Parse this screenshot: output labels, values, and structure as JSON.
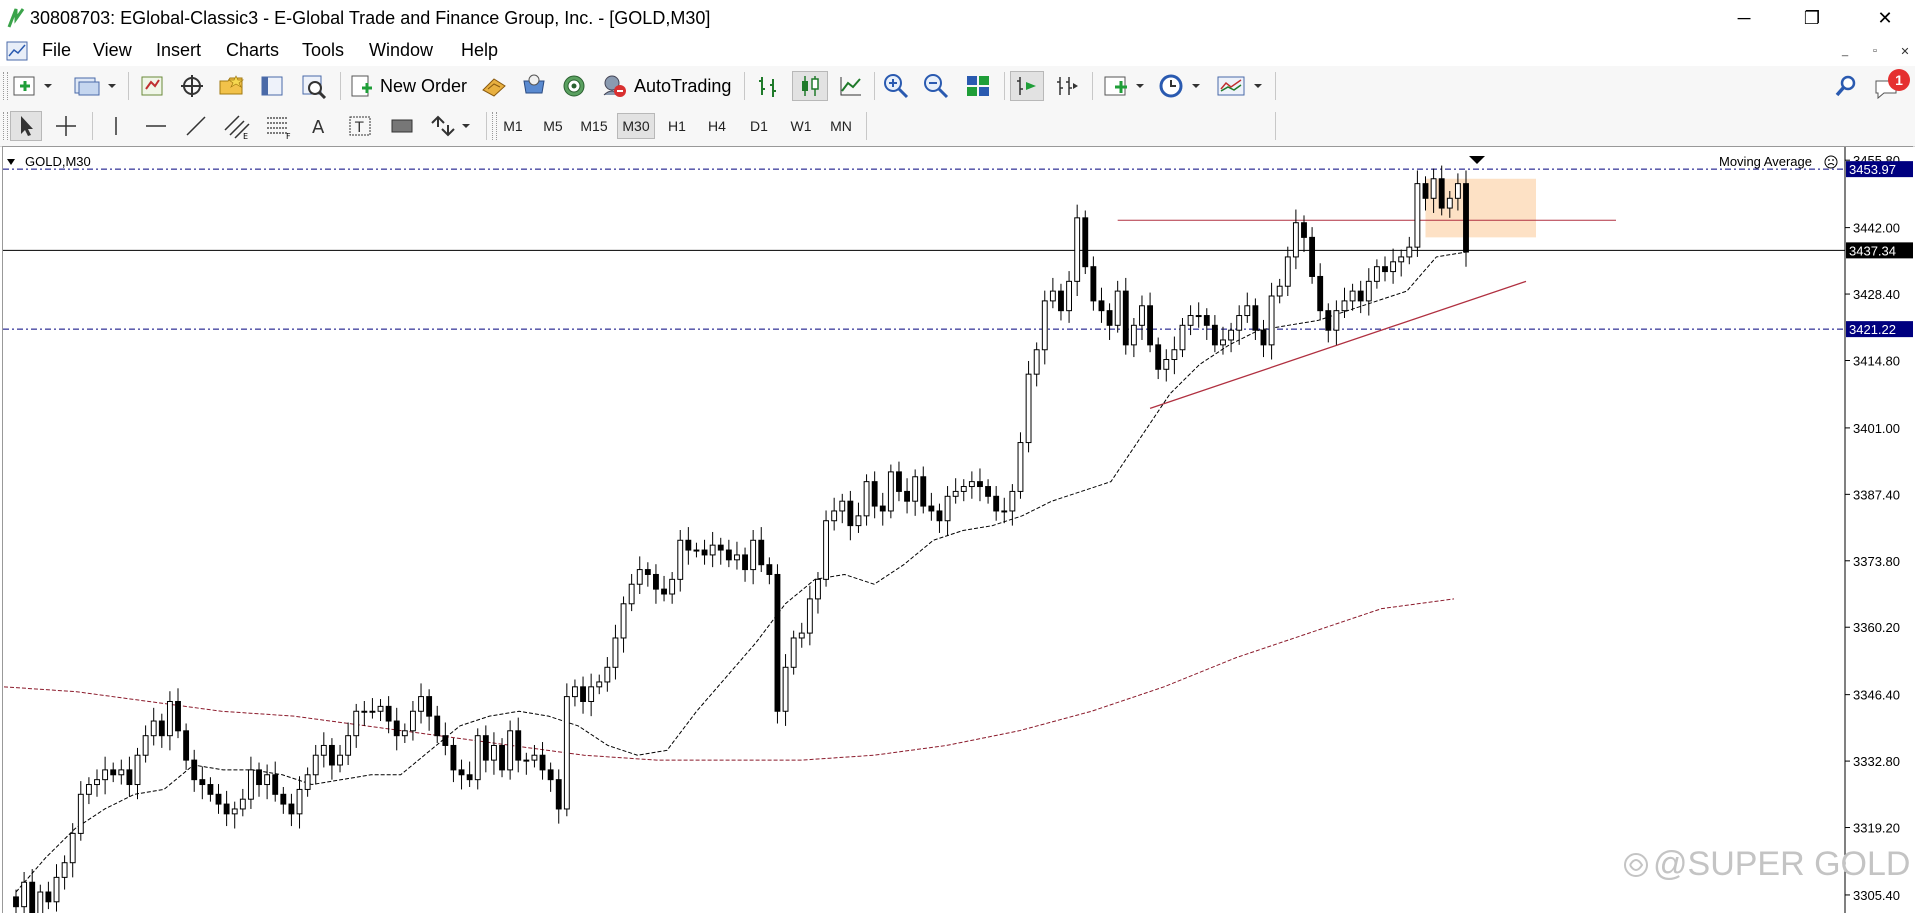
{
  "window": {
    "title": "30808703: EGlobal-Classic3 - E-Global Trade and Finance Group, Inc. - [GOLD,M30]",
    "controls": {
      "minimize": "─",
      "restore": "❐",
      "close": "✕"
    }
  },
  "menu": {
    "items": [
      "File",
      "View",
      "Insert",
      "Charts",
      "Tools",
      "Window",
      "Help"
    ]
  },
  "toolbar": {
    "new_order_label": "New Order",
    "autotrading_label": "AutoTrading",
    "notification_count": "1"
  },
  "timeframes": {
    "items": [
      "M1",
      "M5",
      "M15",
      "M30",
      "H1",
      "H4",
      "D1",
      "W1",
      "MN"
    ],
    "active": "M30"
  },
  "chart": {
    "symbol_label": "GOLD,M30",
    "indicator_label": "Moving Average",
    "watermark": "@SUPER GOLD",
    "price_levels": [
      "3455.80",
      "3442.00",
      "3428.40",
      "3414.80",
      "3401.00",
      "3387.40",
      "3373.80",
      "3360.20",
      "3346.40",
      "3332.80",
      "3319.20",
      "3305.40"
    ],
    "current_price": "3437.34",
    "upper_level": "3453.97",
    "lower_level": "3421.22",
    "colors": {
      "candle": "#000000",
      "ma_fast": "#000000",
      "ma_slow": "#8b1a2b",
      "trendline": "#b03040",
      "highlight_zone": "#fcd9b6",
      "label_box": "#00007f"
    }
  },
  "chart_data": {
    "type": "candlestick",
    "symbol": "GOLD",
    "timeframe": "M30",
    "ylim": [
      3301.5,
      3458.5
    ],
    "current_price": 3437.34,
    "horizontal_lines": [
      3453.97,
      3421.22
    ],
    "resistance_line": 3443.5,
    "closes": [
      3303,
      3308,
      3301,
      3306,
      3304,
      3309,
      3312,
      3318,
      3326,
      3328,
      3329,
      3331,
      3330,
      3331,
      3328,
      3334,
      3338,
      3341,
      3338,
      3345,
      3339,
      3333,
      3329,
      3328,
      3326,
      3324,
      3322,
      3323,
      3325,
      3331,
      3328,
      3330,
      3326,
      3324,
      3322,
      3327,
      3330,
      3334,
      3336,
      3332,
      3334,
      3338,
      3343,
      3343,
      3343,
      3344,
      3341,
      3338,
      3339,
      3343,
      3346,
      3342,
      3338,
      3336,
      3331,
      3330,
      3329,
      3338,
      3333,
      3336,
      3331,
      3339,
      3333,
      3333,
      3334,
      3331,
      3329,
      3323,
      3346,
      3348,
      3345,
      3348,
      3349,
      3352,
      3358,
      3365,
      3369,
      3372,
      3371,
      3368,
      3367,
      3370,
      3378,
      3376,
      3376,
      3375,
      3377,
      3376,
      3374,
      3375,
      3372,
      3378,
      3373,
      3371,
      3343,
      3352,
      3358,
      3359,
      3366,
      3370,
      3382,
      3384,
      3386,
      3381,
      3383,
      3390,
      3385,
      3384,
      3392,
      3388,
      3386,
      3391,
      3385,
      3384,
      3382,
      3387,
      3388,
      3389,
      3390,
      3389,
      3387,
      3384,
      3384,
      3388,
      3398,
      3412,
      3417,
      3427,
      3429,
      3425,
      3431,
      3444,
      3434,
      3427,
      3425,
      3422,
      3429,
      3418,
      3422,
      3426,
      3418,
      3413,
      3415,
      3417,
      3422,
      3424,
      3424,
      3422,
      3418,
      3419,
      3421,
      3424,
      3426,
      3421,
      3418,
      3428,
      3430,
      3436,
      3443,
      3440,
      3432,
      3425,
      3421,
      3425,
      3427,
      3429,
      3427,
      3431,
      3434,
      3433,
      3435,
      3436,
      3438,
      3451,
      3448,
      3452,
      3446,
      3448,
      3451,
      3437
    ],
    "ma_fast": [
      3306,
      3313,
      3319,
      3323,
      3326,
      3327,
      3332,
      3331,
      3331,
      3330,
      3328,
      3329,
      3330,
      3330,
      3335,
      3340,
      3342,
      3343,
      3342,
      3340,
      3336,
      3334,
      3335,
      3343,
      3350,
      3357,
      3365,
      3370,
      3371,
      3369,
      3373,
      3378,
      3380,
      3381,
      3383,
      3386,
      3388,
      3390,
      3399,
      3408,
      3414,
      3418,
      3421,
      3422,
      3423,
      3425,
      3427,
      3429,
      3436,
      3437
    ],
    "ma_slow": [
      3348,
      3347,
      3345,
      3343,
      3342,
      3340,
      3338,
      3336,
      3334,
      3333,
      3333,
      3333,
      3334,
      3336,
      3339,
      3343,
      3348,
      3354,
      3359,
      3364,
      3366
    ]
  }
}
